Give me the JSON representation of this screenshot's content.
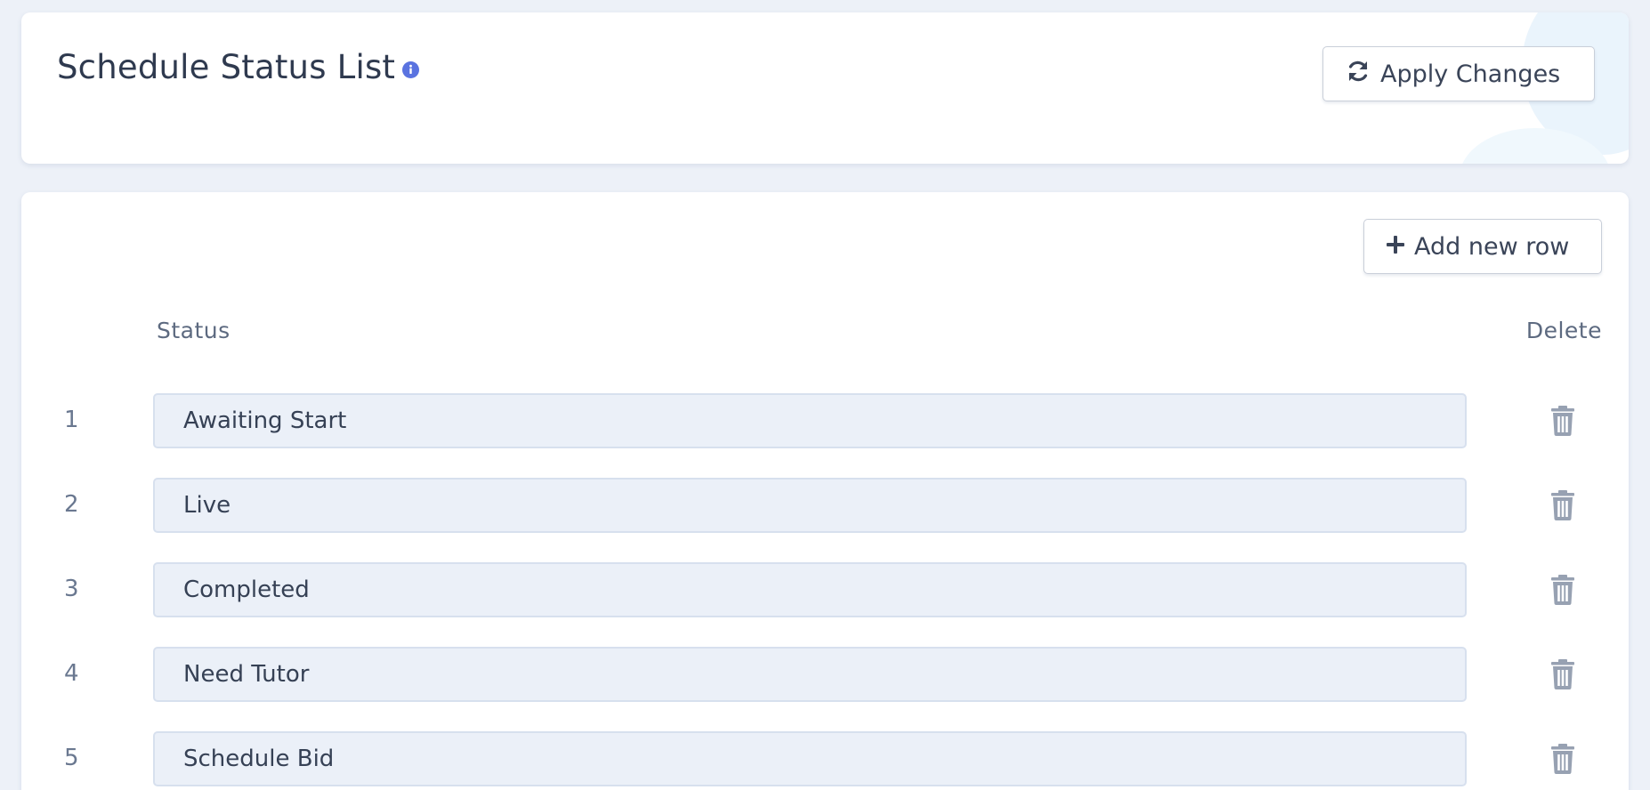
{
  "header": {
    "title": "Schedule Status List",
    "info_icon": "info-circle-icon",
    "apply_button_label": "Apply Changes",
    "apply_button_icon": "refresh-icon"
  },
  "table": {
    "add_row_label": "Add new row",
    "add_row_icon": "plus-icon",
    "columns": {
      "status": "Status",
      "delete": "Delete"
    },
    "rows": [
      {
        "number": "1",
        "status": "Awaiting Start"
      },
      {
        "number": "2",
        "status": "Live"
      },
      {
        "number": "3",
        "status": "Completed"
      },
      {
        "number": "4",
        "status": "Need Tutor"
      },
      {
        "number": "5",
        "status": "Schedule Bid"
      }
    ],
    "delete_icon": "trash-icon"
  },
  "colors": {
    "background": "#edf1f8",
    "accent": "#5a73e0",
    "input_fill": "#ebf0f8"
  }
}
